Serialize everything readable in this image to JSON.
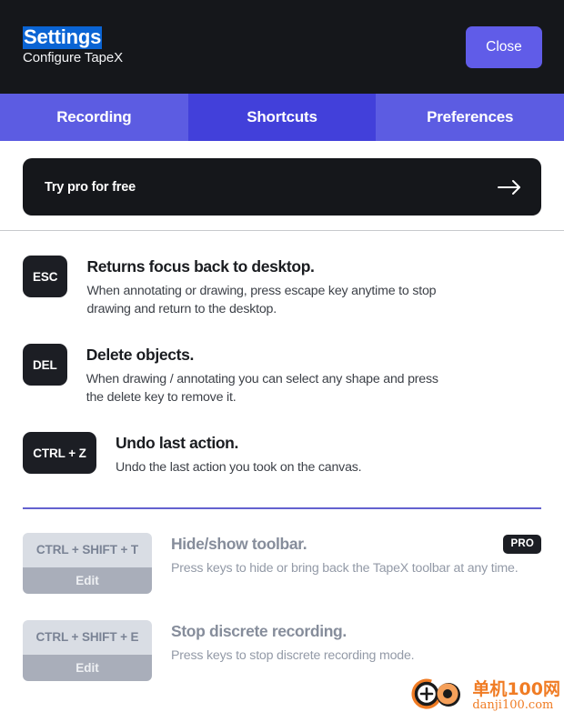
{
  "header": {
    "title": "Settings",
    "subtitle": "Configure TapeX",
    "close_label": "Close",
    "background": "#15171b",
    "title_highlight": "#0a64d4"
  },
  "tabs": {
    "active": "Shortcuts",
    "items": [
      {
        "label": "Recording",
        "active": false
      },
      {
        "label": "Shortcuts",
        "active": true
      },
      {
        "label": "Preferences",
        "active": false
      }
    ],
    "inactive_color": "#5c5ce2",
    "active_color": "#4240da"
  },
  "pro_banner": {
    "label": "Try pro for free",
    "arrow": "arrow-right-icon",
    "background": "#15171b"
  },
  "shortcuts": [
    {
      "keys": "ESC",
      "title": "Returns focus back to desktop.",
      "description": "When annotating or drawing, press escape key anytime to stop drawing and return to the desktop.",
      "locked": false,
      "pro": false
    },
    {
      "keys": "DEL",
      "title": "Delete objects.",
      "description": "When drawing / annotating you can select any shape and press the delete key to remove it.",
      "locked": false,
      "pro": false
    },
    {
      "keys": "CTRL + Z",
      "title": "Undo last action.",
      "description": "Undo the last action you took on the canvas.",
      "locked": false,
      "pro": false
    }
  ],
  "pro_shortcuts": [
    {
      "keys": "CTRL + SHIFT + T",
      "edit_label": "Edit",
      "title": "Hide/show toolbar.",
      "description": "Press keys to hide or bring back the TapeX toolbar at any time.",
      "badge": "PRO",
      "locked": true
    },
    {
      "keys": "CTRL + SHIFT + E",
      "edit_label": "Edit",
      "title": "Stop discrete recording.",
      "description": "Press keys to stop discrete recording mode.",
      "badge": "",
      "locked": true
    }
  ],
  "watermark": {
    "chinese": "单机100网",
    "url": "danji100.com",
    "color": "#f07c24"
  }
}
